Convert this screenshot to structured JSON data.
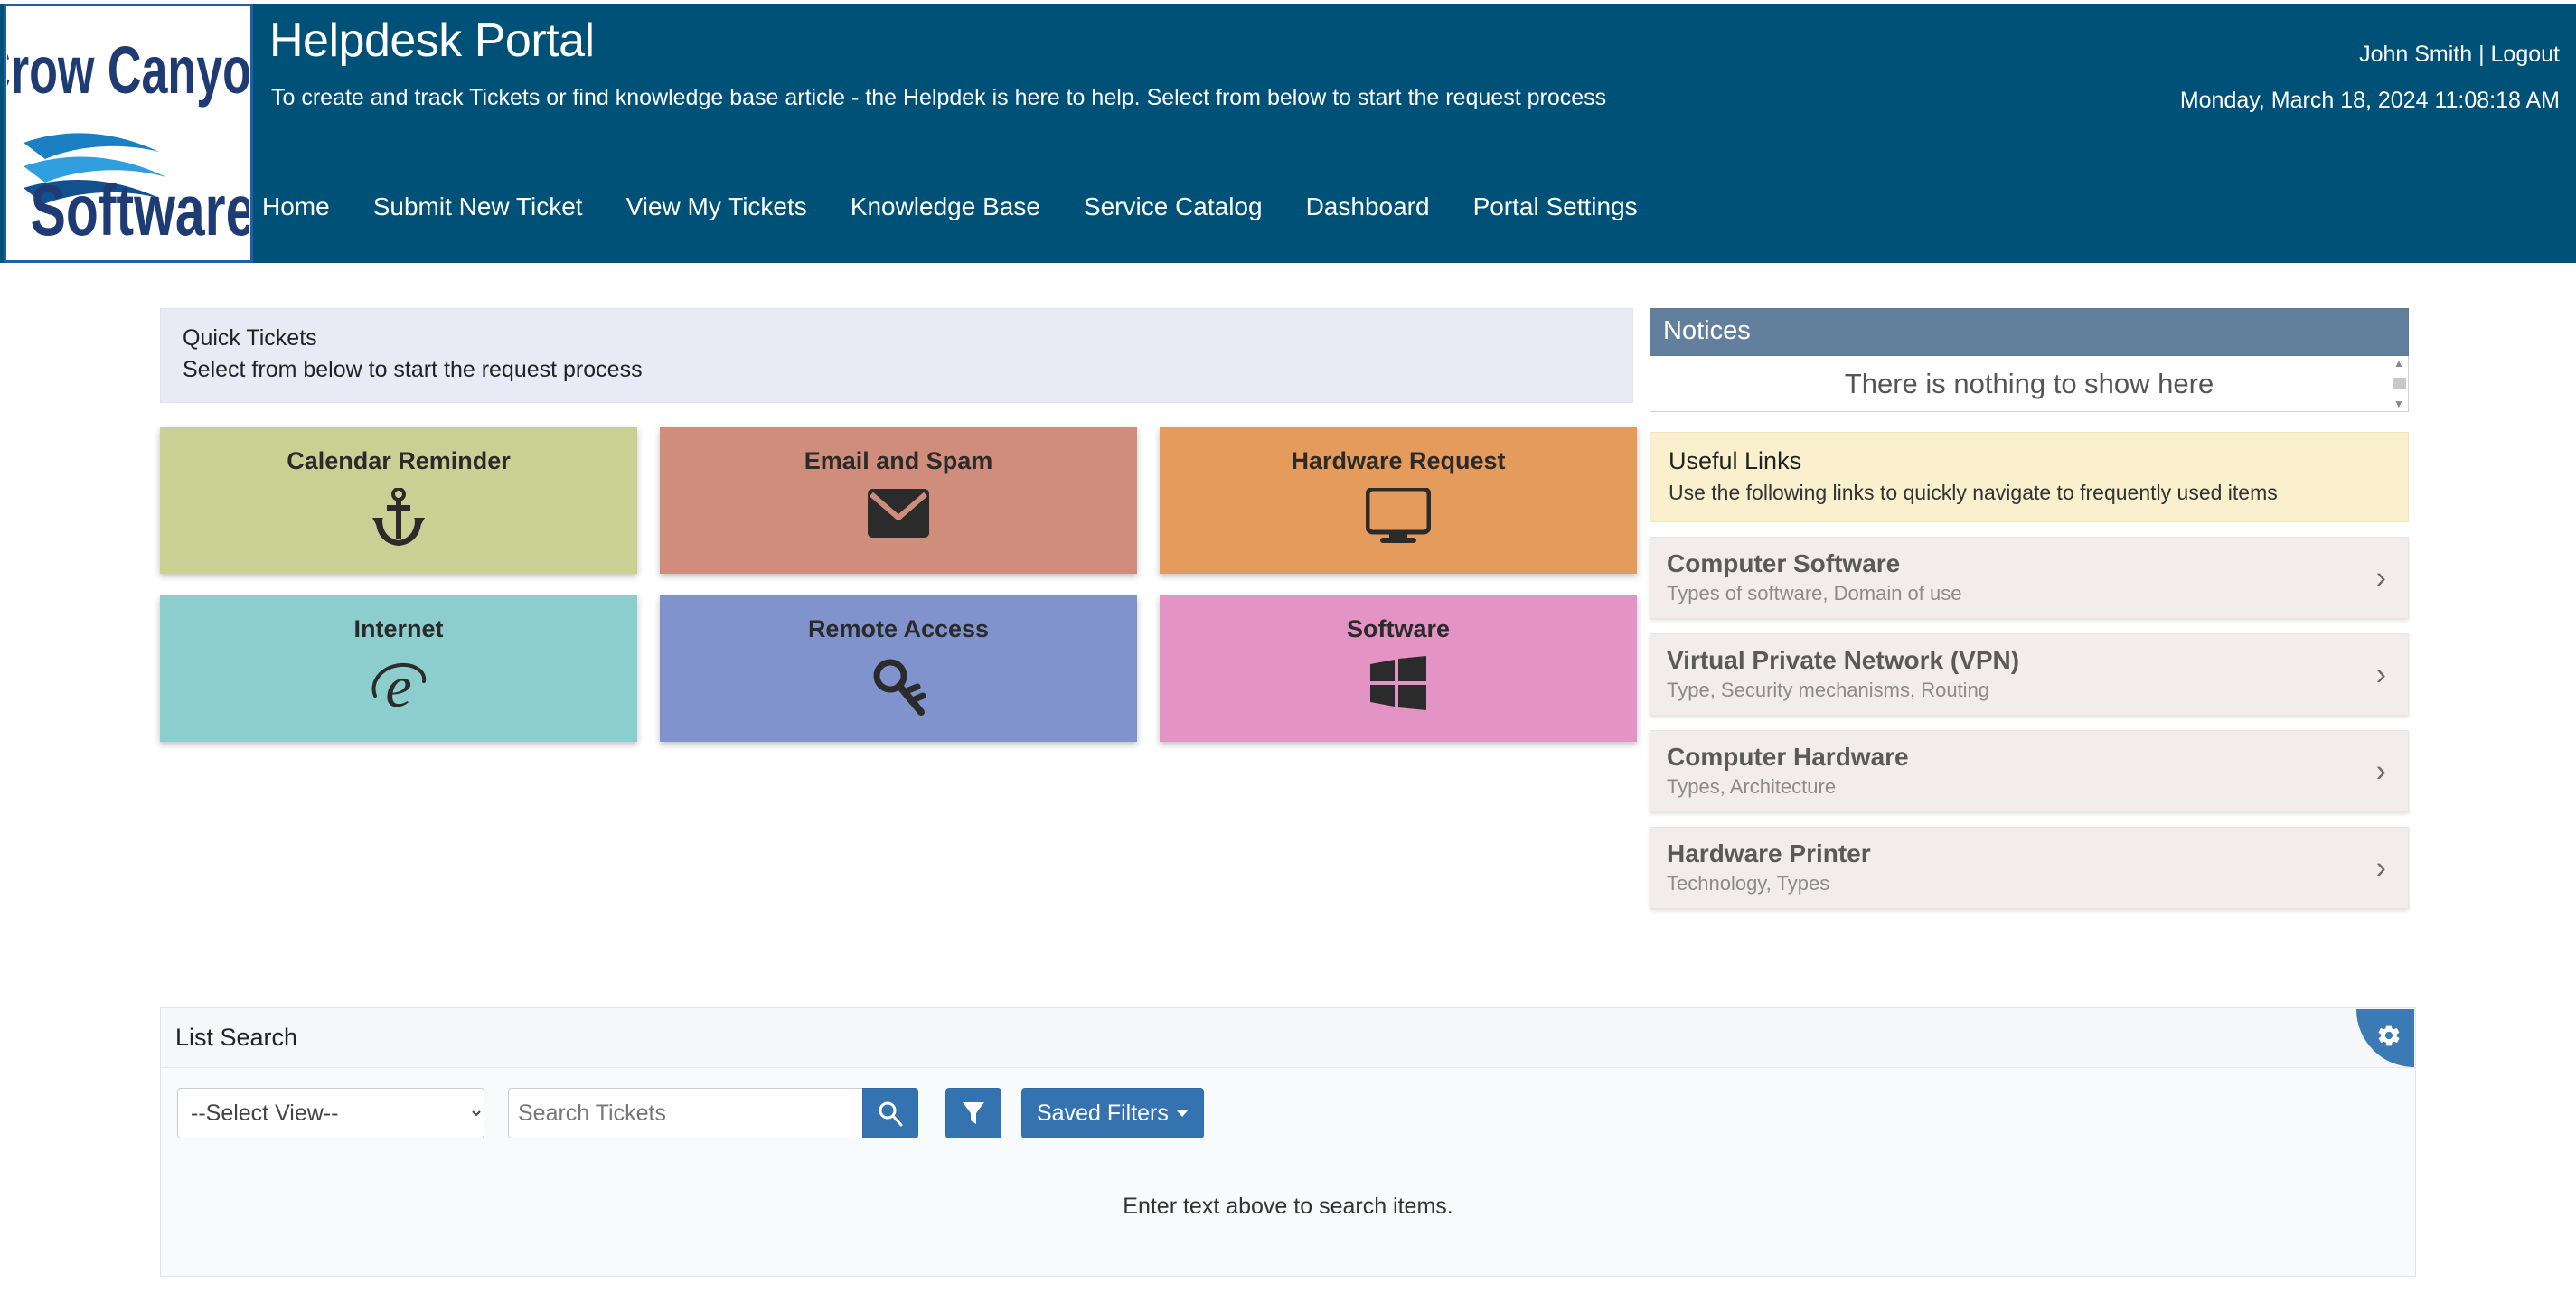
{
  "header": {
    "logo_line1": "Crow Canyon",
    "logo_line2": "Software",
    "title": "Helpdesk Portal",
    "subtitle": "To create and track Tickets or find knowledge base article - the Helpdek is here to help. Select from below to start the request process",
    "user": "John Smith |",
    "logout": "Logout",
    "datetime": "Monday, March 18, 2024 11:08:18 AM",
    "bg_color": "#005177"
  },
  "nav": {
    "items": [
      {
        "label": "Home"
      },
      {
        "label": "Submit New Ticket"
      },
      {
        "label": "View My Tickets"
      },
      {
        "label": "Knowledge Base"
      },
      {
        "label": "Service Catalog"
      },
      {
        "label": "Dashboard"
      },
      {
        "label": "Portal Settings"
      }
    ]
  },
  "quick_tickets": {
    "title": "Quick Tickets",
    "subtitle": "Select from below to start the request process",
    "tiles": [
      {
        "label": "Calendar Reminder",
        "icon": "anchor-icon",
        "color": "#c8d094"
      },
      {
        "label": "Email and Spam",
        "icon": "envelope-icon",
        "color": "#d08d7c"
      },
      {
        "label": "Hardware Request",
        "icon": "monitor-icon",
        "color": "#e59b5c"
      },
      {
        "label": "Internet",
        "icon": "internet-explorer-icon",
        "color": "#8ccdcd"
      },
      {
        "label": "Remote Access",
        "icon": "key-icon",
        "color": "#8093cd"
      },
      {
        "label": "Software",
        "icon": "windows-icon",
        "color": "#e494c4"
      }
    ]
  },
  "notices": {
    "title": "Notices",
    "empty_message": "There is nothing to show here",
    "header_color": "#62809e"
  },
  "useful_links": {
    "title": "Useful Links",
    "subtitle": "Use the following links to quickly navigate to frequently used items",
    "items": [
      {
        "title": "Computer Software",
        "subtitle": "Types of software, Domain of use"
      },
      {
        "title": "Virtual Private Network (VPN)",
        "subtitle": "Type, Security mechanisms, Routing"
      },
      {
        "title": "Computer Hardware",
        "subtitle": "Types, Architecture"
      },
      {
        "title": "Hardware Printer",
        "subtitle": "Technology, Types"
      }
    ],
    "chevron": "›"
  },
  "list_search": {
    "title": "List Search",
    "view_selected": "--Select View--",
    "view_options": [
      "--Select View--"
    ],
    "search_placeholder": "Search Tickets",
    "search_value": "",
    "saved_filters_label": "Saved Filters",
    "empty_message": "Enter text above to search items.",
    "accent_color": "#3573b0"
  }
}
